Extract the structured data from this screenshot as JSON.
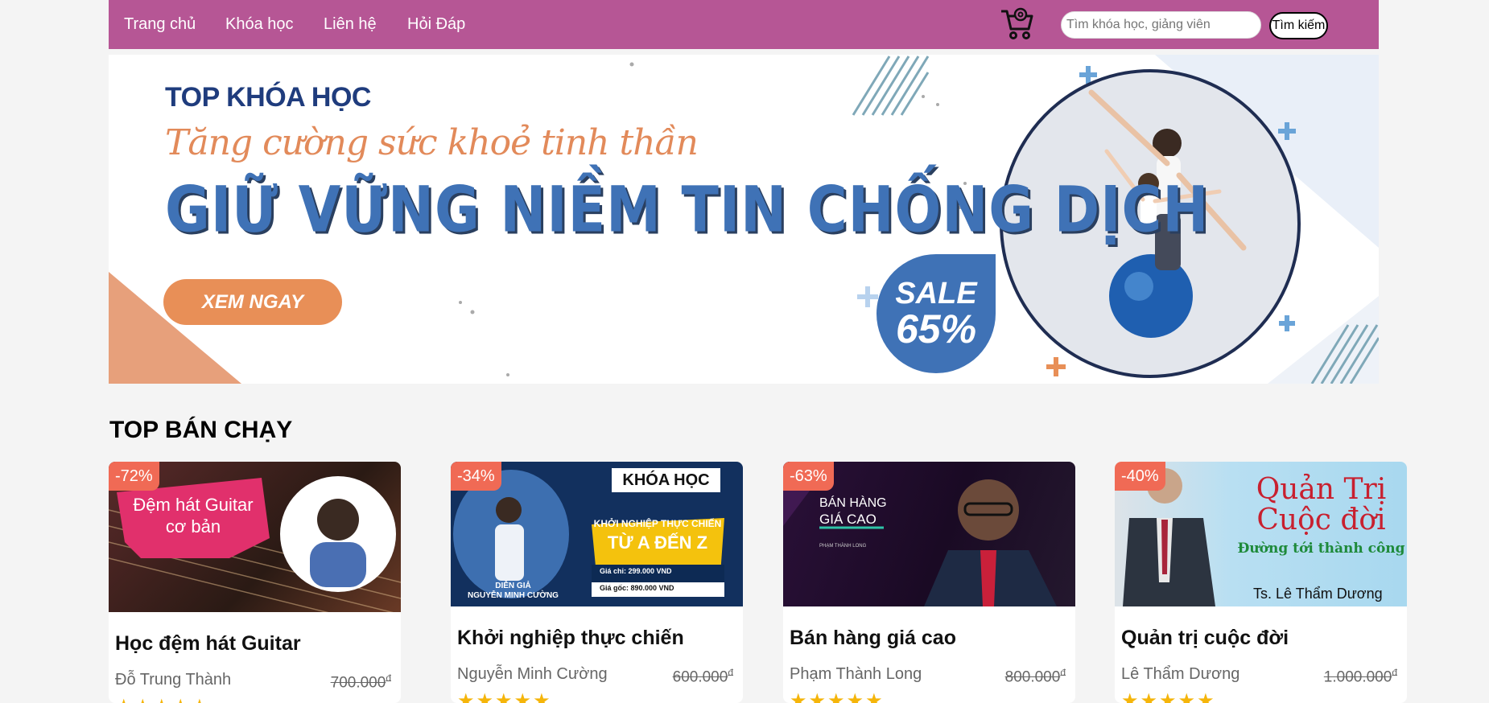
{
  "nav": {
    "items": [
      "Trang chủ",
      "Khóa học",
      "Liên hệ",
      "Hỏi Đáp"
    ],
    "cart_icon": "shopping-cart-icon",
    "search_placeholder": "Tìm khóa học, giảng viên",
    "search_value": "",
    "search_button": "Tìm kiếm",
    "bar_color": "#b65695"
  },
  "banner": {
    "kicker": "TOP KHÓA HỌC",
    "script_line": "Tăng cường sức khoẻ tinh thần",
    "headline": "GIỮ VỮNG NIỀM TIN CHỐNG DỊCH",
    "cta": "XEM NGAY",
    "sale_word": "SALE",
    "sale_percent": "65%",
    "accent_blue": "#3f72b6",
    "accent_orange": "#e88f57"
  },
  "section": {
    "title": "TOP BÁN CHẠY"
  },
  "courses": [
    {
      "discount": "-72%",
      "thumb_text": [
        "Đệm hát Guitar",
        "cơ bản"
      ],
      "title": "Học đệm hát Guitar",
      "author": "Đỗ Trung Thành",
      "old_price": "700.000",
      "currency": "đ",
      "rating_stars": "★★★★★",
      "rating": 5
    },
    {
      "discount": "-34%",
      "thumb_text": [
        "KHÓA HỌC",
        "KHỞI NGHIỆP THỰC CHIẾN",
        "TỪ A ĐẾN Z",
        "Giá chỉ: 299.000 VND",
        "Giá gốc: 890.000 VND",
        "DIỄN GIẢ",
        "NGUYỄN MINH CƯỜNG"
      ],
      "title": "Khởi nghiệp thực chiến",
      "author": "Nguyễn Minh Cường",
      "old_price": "600.000",
      "currency": "đ",
      "rating_stars": "★★★★★",
      "rating": 5
    },
    {
      "discount": "-63%",
      "thumb_text": [
        "BÁN HÀNG",
        "GIÁ CAO",
        "PHẠM THÀNH LONG"
      ],
      "title": "Bán hàng giá cao",
      "author": "Phạm Thành Long",
      "old_price": "800.000",
      "currency": "đ",
      "rating_stars": "★★★★★",
      "rating": 5
    },
    {
      "discount": "-40%",
      "thumb_text": [
        "Quản Trị",
        "Cuộc đời",
        "Đường tới thành công",
        "Ts. Lê Thẩm Dương"
      ],
      "title": "Quản trị cuộc đời",
      "author": "Lê Thẩm Dương",
      "old_price": "1.000.000",
      "currency": "đ",
      "rating_stars": "★★★★★",
      "rating": 5
    }
  ]
}
